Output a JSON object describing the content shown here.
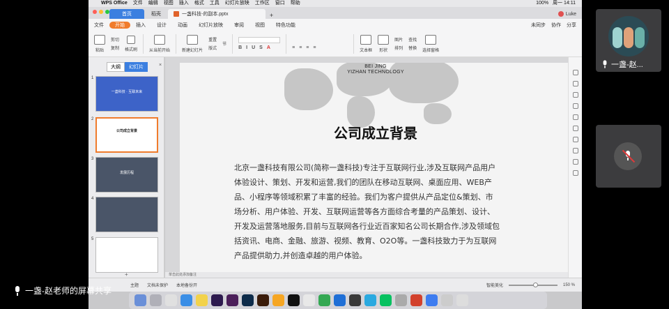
{
  "mac_menubar": {
    "app": "WPS Office",
    "items": [
      "文件",
      "编辑",
      "视图",
      "插入",
      "格式",
      "工具",
      "幻灯片放映",
      "工作区",
      "窗口",
      "帮助"
    ],
    "battery": "100%",
    "clock": "周一 14:11"
  },
  "tabs": {
    "home": "首页",
    "template": "稻壳",
    "document": "一盏科技-的副本.pptx",
    "user": "Luke"
  },
  "menu": {
    "file": "文件",
    "items": [
      "开始",
      "插入",
      "设计",
      "动画",
      "幻灯片放映",
      "审阅",
      "视图",
      "特色功能"
    ],
    "active": "开始",
    "right": [
      "未同步",
      "协作",
      "分享"
    ]
  },
  "ribbon": {
    "paste": "粘贴",
    "cut": "剪切",
    "copy": "复制",
    "format_painter": "格式刷",
    "from_current": "从当前开始",
    "new_slide": "新建幻灯片",
    "layout": "版式",
    "section": "节",
    "reset": "重置",
    "text_box": "文本框",
    "shape": "形状",
    "picture": "图片",
    "arrange": "排列",
    "find": "查找",
    "replace": "替换",
    "select_pane": "选择窗格"
  },
  "left_pane": {
    "outline_tab": "大纲",
    "slides_tab": "幻灯片",
    "thumb_titles": [
      "一盏科技 · 互联未来",
      "公司成立背景",
      "发展历程",
      "",
      ""
    ]
  },
  "slide": {
    "sub1": "BEI JING",
    "sub2": "YIZHAN TECHNOLOGY",
    "title": "公司成立背景",
    "body": "北京一盏科技有限公司(简称一盏科技)专注于互联网行业,涉及互联网产品用户体验设计、策划、开发和运营,我们的团队在移动互联网、桌面应用、WEB产品、小程序等领域积累了丰富的经验。我们为客户提供从产品定位&策划、市场分析、用户体验、开发、互联网运营等各方面综合考量的产品策划、设计、开发及运营落地服务,目前与互联网各行业近百家知名公司长期合作,涉及领域包括资讯、电商、金融、旅游、视频、教育、O2O等。一盏科技致力于为互联网产品提供助力,并创造卓越的用户体验。"
  },
  "notes_placeholder": "单击此处添加备注",
  "status": {
    "theme": "主题",
    "doc_protect": "文档未保护",
    "local_backup": "本地备份开",
    "smart_beautify": "智能美化",
    "zoom": "150 %"
  },
  "overlay": {
    "caption": "一盏-赵老师的屏幕共享",
    "participant": "一盏-赵..."
  }
}
